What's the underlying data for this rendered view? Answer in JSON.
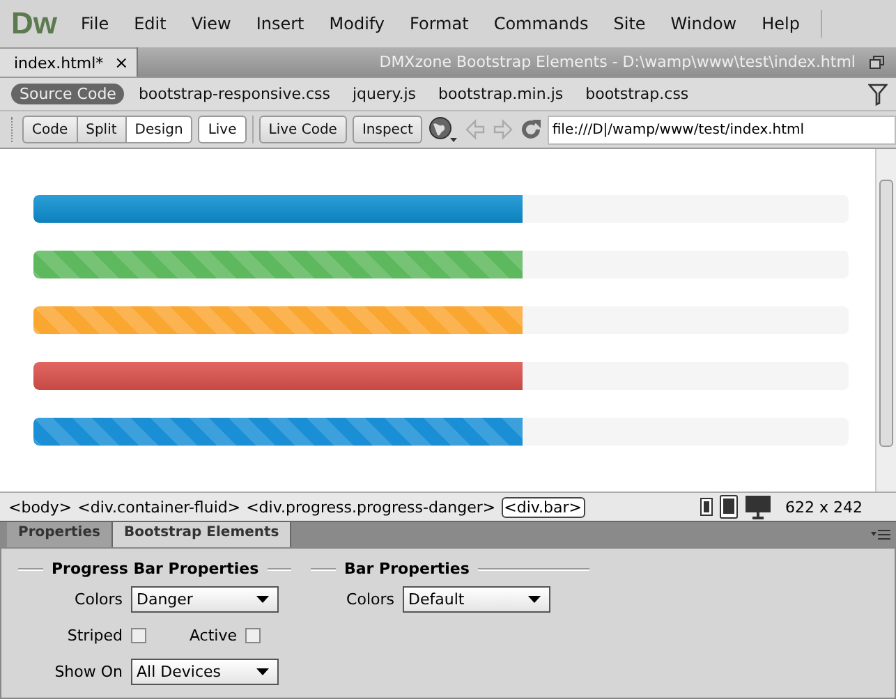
{
  "app": {
    "logo": "Dw"
  },
  "menu": [
    "File",
    "Edit",
    "View",
    "Insert",
    "Modify",
    "Format",
    "Commands",
    "Site",
    "Window",
    "Help"
  ],
  "document_tab": {
    "label": "index.html*",
    "close": "×"
  },
  "window": {
    "title": "DMXzone Bootstrap Elements - D:\\wamp\\www\\test\\index.html"
  },
  "related_files": [
    {
      "label": "Source Code",
      "selected": true
    },
    {
      "label": "bootstrap-responsive.css",
      "selected": false
    },
    {
      "label": "jquery.js",
      "selected": false
    },
    {
      "label": "bootstrap.min.js",
      "selected": false
    },
    {
      "label": "bootstrap.css",
      "selected": false
    }
  ],
  "view_buttons": [
    {
      "label": "Code",
      "selected": false
    },
    {
      "label": "Split",
      "selected": false
    },
    {
      "label": "Design",
      "selected": true
    }
  ],
  "live_button": {
    "label": "Live"
  },
  "tool_buttons": [
    "Live Code",
    "Inspect"
  ],
  "address": {
    "value": "file:///D|/wamp/www/test/index.html"
  },
  "progress_bars": [
    {
      "color": "#0e90d2",
      "striped": false,
      "level": 0.6
    },
    {
      "color": "#5eb95e",
      "striped": true,
      "level": 0.6
    },
    {
      "color": "#faa732",
      "striped": true,
      "level": 0.6
    },
    {
      "color": "#dd514c",
      "striped": false,
      "level": 0.6
    },
    {
      "color": "#1a8fd6",
      "striped": true,
      "level": 0.6
    }
  ],
  "tag_selector": [
    {
      "label": "<body>",
      "selected": false
    },
    {
      "label": "<div.container-fluid>",
      "selected": false
    },
    {
      "label": "<div.progress.progress-danger>",
      "selected": false
    },
    {
      "label": "<div.bar>",
      "selected": true
    }
  ],
  "window_size": "622 x 242",
  "panel_tabs": [
    {
      "label": "Properties",
      "selected": false
    },
    {
      "label": "Bootstrap Elements",
      "selected": true
    }
  ],
  "progress_bar_properties": {
    "title": "Progress Bar Properties",
    "colors_label": "Colors",
    "colors_value": "Danger",
    "striped_label": "Striped",
    "striped": false,
    "active_label": "Active",
    "active": false,
    "show_on_label": "Show On",
    "show_on_value": "All Devices"
  },
  "bar_properties": {
    "title": "Bar Properties",
    "colors_label": "Colors",
    "colors_value": "Default"
  }
}
